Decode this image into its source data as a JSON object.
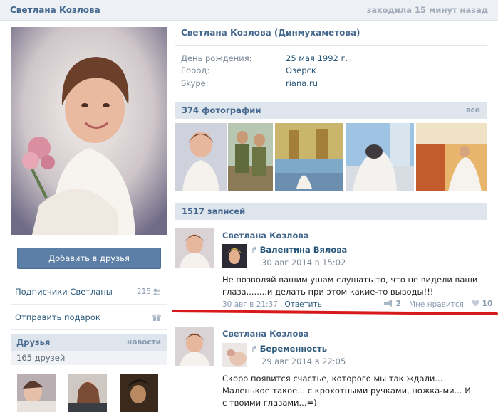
{
  "header": {
    "name": "Светлана Козлова",
    "status": "заходила 15 минут назад"
  },
  "sidebar": {
    "add_friend_label": "Добавить в друзья",
    "subscribers_label": "Подписчики Светланы",
    "subscribers_count": "215",
    "gift_label": "Отправить подарок",
    "friends_title": "Друзья",
    "friends_news": "новости",
    "friends_count": "165 друзей"
  },
  "profile": {
    "full_name": "Светлана Козлова (Динмухаметова)",
    "birthday_label": "День рождения:",
    "birthday_value": "25 мая 1992 г.",
    "city_label": "Город:",
    "city_value": "Озерск",
    "skype_label": "Skype:",
    "skype_value": "riana.ru"
  },
  "photos": {
    "title": "374 фотографии",
    "all_label": "все"
  },
  "wall": {
    "title": "1517 записей",
    "posts": [
      {
        "author": "Светлана Козлова",
        "repost_name": "Валентина Вялова",
        "repost_date": "30 авг 2014 в 15:02",
        "text": "Не позволяй вашим ушам слушать то, что не видели ваши глаза........и делать при этом какие-то выводы!!!",
        "date": "30 авг в 21:37",
        "reply_label": "Ответить",
        "shares": "2",
        "like_label": "Мне нравится",
        "likes": "10"
      },
      {
        "author": "Светлана Козлова",
        "repost_name": "Беременность",
        "repost_date": "29 авг 2014 в 22:05",
        "text": "Скоро появится счастье, которого мы так ждали... Маленькое такое... с крохотными ручками, ножка-ми... И с твоими глазами...=)"
      }
    ]
  },
  "repost_arrow": "↱",
  "colors": {
    "link": "#2b587a",
    "header_bg": "#dee5ec",
    "button": "#5b7fa6",
    "highlight": "#d7191c"
  }
}
